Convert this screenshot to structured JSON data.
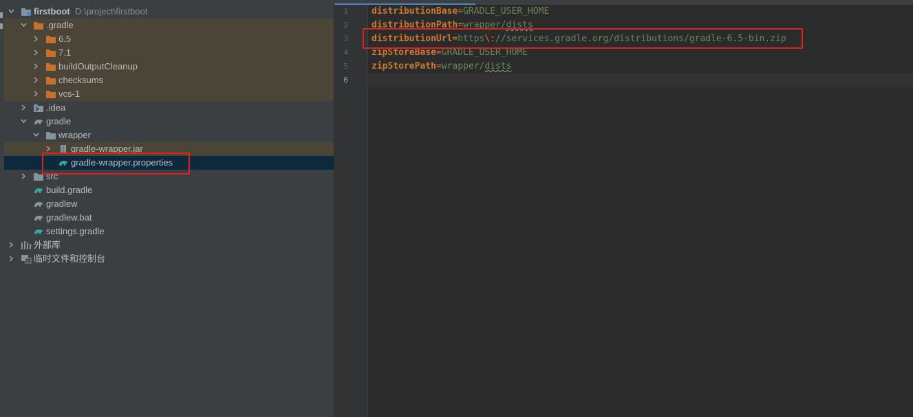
{
  "project_tree": {
    "root": {
      "label": "firstboot",
      "path": "D:\\project\\firstboot"
    },
    "items": [
      {
        "label": ".gradle"
      },
      {
        "label": "6.5"
      },
      {
        "label": "7.1"
      },
      {
        "label": "buildOutputCleanup"
      },
      {
        "label": "checksums"
      },
      {
        "label": "vcs-1"
      },
      {
        "label": ".idea"
      },
      {
        "label": "gradle"
      },
      {
        "label": "wrapper"
      },
      {
        "label": "gradle-wrapper.jar"
      },
      {
        "label": "gradle-wrapper.properties"
      },
      {
        "label": "src"
      },
      {
        "label": "build.gradle"
      },
      {
        "label": "gradlew"
      },
      {
        "label": "gradlew.bat"
      },
      {
        "label": "settings.gradle"
      },
      {
        "label": "外部库"
      },
      {
        "label": "临时文件和控制台"
      }
    ]
  },
  "editor": {
    "line_numbers": [
      "1",
      "2",
      "3",
      "4",
      "5",
      "6"
    ],
    "lines": [
      {
        "key": "distributionBase",
        "eq": "=",
        "value": "GRADLE_USER_HOME"
      },
      {
        "key": "distributionPath",
        "eq": "=",
        "value_a": "wrapper/",
        "value_b": "dists"
      },
      {
        "key": "distributionUrl",
        "eq": "=",
        "value_a": "https",
        "esc": "\\:",
        "value_b": "//services.gradle.org/distributions/gradle-6.5-bin.zip"
      },
      {
        "key": "zipStoreBase",
        "eq": "=",
        "value": "GRADLE_USER_HOME"
      },
      {
        "key": "zipStorePath",
        "eq": "=",
        "value_a": "wrapper/",
        "value_b": "dists"
      }
    ]
  },
  "colors": {
    "selection": "#0d293e",
    "excluded_bg": "#4b4537",
    "folder_orange": "#c8702e",
    "gradle_teal": "#39a3a0",
    "highlight_box": "#e02020",
    "property_key": "#cc7832",
    "property_value": "#6a8759"
  }
}
